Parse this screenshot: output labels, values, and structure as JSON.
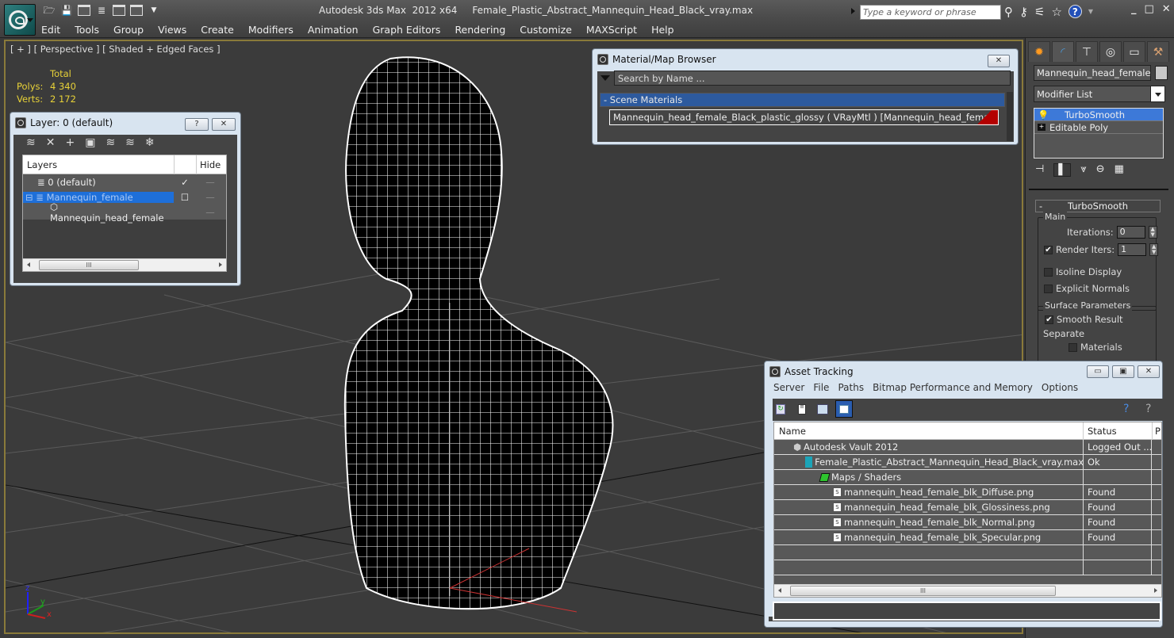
{
  "app": {
    "title": "Autodesk 3ds Max  2012 x64     Female_Plastic_Abstract_Mannequin_Head_Black_vray.max",
    "menu": [
      "Edit",
      "Tools",
      "Group",
      "Views",
      "Create",
      "Modifiers",
      "Animation",
      "Graph Editors",
      "Rendering",
      "Customize",
      "MAXScript",
      "Help"
    ],
    "search_placeholder": "Type a keyword or phrase",
    "quick_access_icons": [
      "open-icon",
      "save-icon",
      "undo-icon",
      "redo-icon",
      "hold-icon",
      "fetch-icon",
      "more-icon"
    ],
    "info_icons": [
      "binoculars-icon",
      "key-icon",
      "satellite-icon",
      "star-icon",
      "help-icon"
    ],
    "window_controls": {
      "minimize": "_",
      "maximize": "□",
      "close": "✕"
    }
  },
  "viewport": {
    "label": "[ + ] [ Perspective ] [ Shaded + Edged Faces ]",
    "stats": {
      "header": "Total",
      "polys_label": "Polys:",
      "polys": "4 340",
      "verts_label": "Verts:",
      "verts": "2 172"
    },
    "axis": {
      "x": "x",
      "y": "y",
      "z": "z"
    },
    "accent_color": "#8a7a3a"
  },
  "layer_dialog": {
    "title": "Layer: 0 (default)",
    "help_btn": "?",
    "close_btn": "✕",
    "toolbar_icons": [
      "create-layer-icon",
      "delete-layer-icon",
      "add-to-layer-icon",
      "select-objects-icon",
      "highlight-layer-icon",
      "hide-unhide-icon",
      "freeze-icon"
    ],
    "columns": {
      "layers": "Layers",
      "hide": "Hide"
    },
    "rows": [
      {
        "name": "0 (default)",
        "check": "✓",
        "level": 1,
        "selected": false
      },
      {
        "name": "Mannequin_female",
        "check": "☐",
        "level": 0,
        "selected": true
      },
      {
        "name": "Mannequin_head_female",
        "check": "",
        "level": 2,
        "selected": false
      }
    ],
    "scroll_grip": "III"
  },
  "material_browser": {
    "title": "Material/Map Browser",
    "close_btn": "✕",
    "search_placeholder": "Search by Name ...",
    "category": "- Scene Materials",
    "item": "Mannequin_head_female_Black_plastic_glossy ( VRayMtl ) [Mannequin_head_female]",
    "swatch_color": "#b30000"
  },
  "command_panel": {
    "tabs": [
      "create-tab",
      "modify-tab",
      "hierarchy-tab",
      "motion-tab",
      "display-tab",
      "utilities-tab"
    ],
    "object_name": "Mannequin_head_female",
    "modifier_list": "Modifier List",
    "stack": [
      {
        "name": "TurboSmooth",
        "selected": true
      },
      {
        "name": "Editable Poly",
        "selected": false
      }
    ],
    "rollout_title": "TurboSmooth",
    "main_group": "Main",
    "iterations_label": "Iterations:",
    "iterations": "0",
    "render_iters_label": "Render Iters:",
    "render_iters": "1",
    "render_iters_checked": true,
    "isoline_label": "Isoline Display",
    "explicit_normals_label": "Explicit Normals",
    "surface_group": "Surface Parameters",
    "smooth_result_label": "Smooth Result",
    "smooth_result_checked": true,
    "separate_label": "Separate",
    "materials_label": "Materials"
  },
  "asset_tracking": {
    "title": "Asset Tracking",
    "menu": [
      "Server",
      "File",
      "Paths",
      "Bitmap Performance and Memory",
      "Options"
    ],
    "columns": {
      "name": "Name",
      "status": "Status",
      "extra": "P"
    },
    "rows": [
      {
        "name": "Autodesk Vault 2012",
        "status": "Logged Out ...",
        "indent": 1,
        "icon": "vault-icon"
      },
      {
        "name": "Female_Plastic_Abstract_Mannequin_Head_Black_vray.max",
        "status": "Ok",
        "indent": 2,
        "icon": "max-file-icon"
      },
      {
        "name": "Maps / Shaders",
        "status": "",
        "indent": 3,
        "icon": "maps-icon"
      },
      {
        "name": "mannequin_head_female_blk_Diffuse.png",
        "status": "Found",
        "indent": 4,
        "icon": "png-file-icon"
      },
      {
        "name": "mannequin_head_female_blk_Glossiness.png",
        "status": "Found",
        "indent": 4,
        "icon": "png-file-icon"
      },
      {
        "name": "mannequin_head_female_blk_Normal.png",
        "status": "Found",
        "indent": 4,
        "icon": "png-file-icon"
      },
      {
        "name": "mannequin_head_female_blk_Specular.png",
        "status": "Found",
        "indent": 4,
        "icon": "png-file-icon"
      }
    ],
    "scroll_grip": "III"
  }
}
